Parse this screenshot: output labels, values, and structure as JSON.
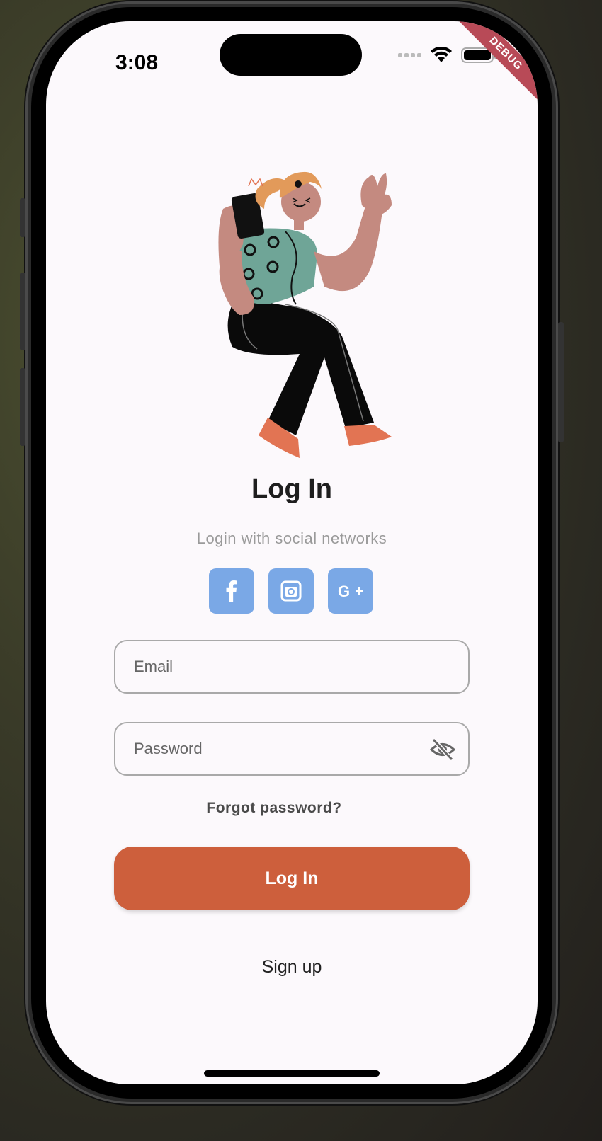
{
  "status_bar": {
    "time": "3:08"
  },
  "debug_banner": "DEBUG",
  "login": {
    "title": "Log In",
    "subtitle": "Login with social networks",
    "social": [
      {
        "icon": "facebook-icon"
      },
      {
        "icon": "instagram-icon"
      },
      {
        "icon": "google-plus-icon"
      }
    ],
    "email_placeholder": "Email",
    "password_placeholder": "Password",
    "forgot_password": "Forgot password?",
    "login_button": "Log In",
    "signup_link": "Sign up"
  },
  "colors": {
    "primary": "#cd5f3c",
    "social_button": "#7aa8e6",
    "background": "#fcf9fc",
    "debug_banner": "#b84a57"
  }
}
